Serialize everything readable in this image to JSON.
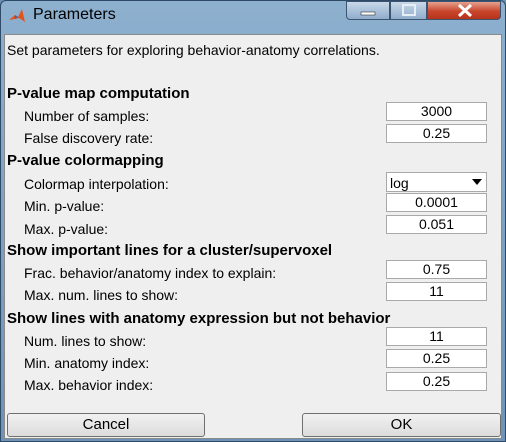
{
  "window": {
    "title": "Parameters"
  },
  "intro": "Set parameters for exploring behavior-anatomy correlations.",
  "sections": {
    "pvalue_map": {
      "header": "P-value map computation",
      "num_samples_label": "Number of samples:",
      "num_samples_value": "3000",
      "fdr_label": "False discovery rate:",
      "fdr_value": "0.25"
    },
    "colormapping": {
      "header": "P-value colormapping",
      "interp_label": "Colormap interpolation:",
      "interp_value": "log",
      "min_p_label": "Min. p-value:",
      "min_p_value": "0.0001",
      "max_p_label": "Max. p-value:",
      "max_p_value": "0.051"
    },
    "important_lines": {
      "header": "Show important lines for a cluster/supervoxel",
      "frac_label": "Frac. behavior/anatomy index to explain:",
      "frac_value": "0.75",
      "max_lines_label": "Max. num. lines to show:",
      "max_lines_value": "11"
    },
    "anatomy_not_behavior": {
      "header": "Show lines with anatomy expression but not behavior",
      "num_lines_label": "Num. lines to show:",
      "num_lines_value": "11",
      "min_anat_label": "Min. anatomy index:",
      "min_anat_value": "0.25",
      "max_beh_label": "Max. behavior index:",
      "max_beh_value": "0.25"
    }
  },
  "buttons": {
    "cancel": "Cancel",
    "ok": "OK"
  }
}
